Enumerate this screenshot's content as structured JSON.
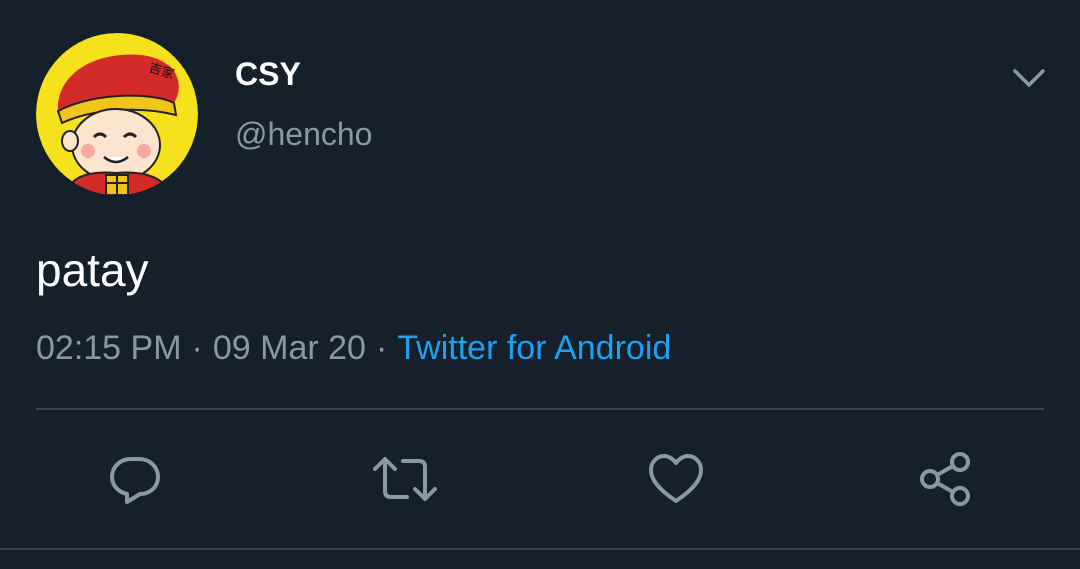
{
  "tweet": {
    "display_name": "CSY",
    "handle": "@hencho",
    "text": "patay",
    "time": "02:15 PM",
    "separator": "·",
    "date": "09 Mar 20",
    "source": "Twitter for Android"
  },
  "avatar": {
    "description_icon": "cartoon-chef-avatar",
    "badge_text": "吉家"
  },
  "actions": {
    "reply_icon": "reply-icon",
    "retweet_icon": "retweet-icon",
    "like_icon": "heart-icon",
    "share_icon": "share-icon",
    "more_icon": "chevron-down-icon"
  },
  "colors": {
    "background": "#15202b",
    "primary_text": "#ffffff",
    "secondary_text": "#8899a6",
    "link": "#1da1f2",
    "divider": "#38444d",
    "icon": "#8899a6"
  }
}
